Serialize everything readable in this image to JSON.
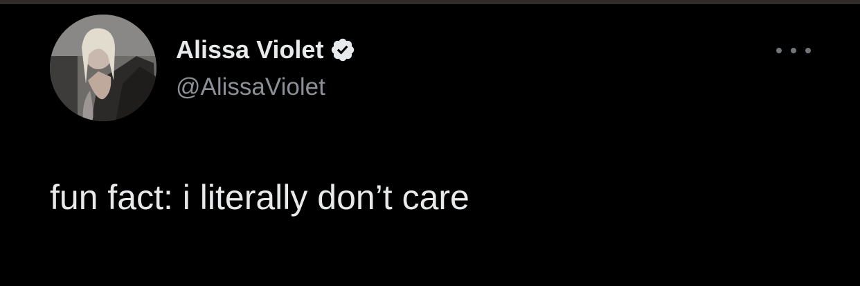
{
  "tweet": {
    "author": {
      "display_name": "Alissa Violet",
      "handle": "@AlissaViolet",
      "verified": true,
      "avatar_icon": "profile-photo"
    },
    "more_icon": "more-options-icon",
    "text": "fun fact: i literally don’t care"
  },
  "colors": {
    "background": "#000000",
    "text_primary": "#e7e9ea",
    "text_secondary": "#8b9096",
    "icon_muted": "#71767b",
    "verified_badge": "#e7e9ea"
  }
}
